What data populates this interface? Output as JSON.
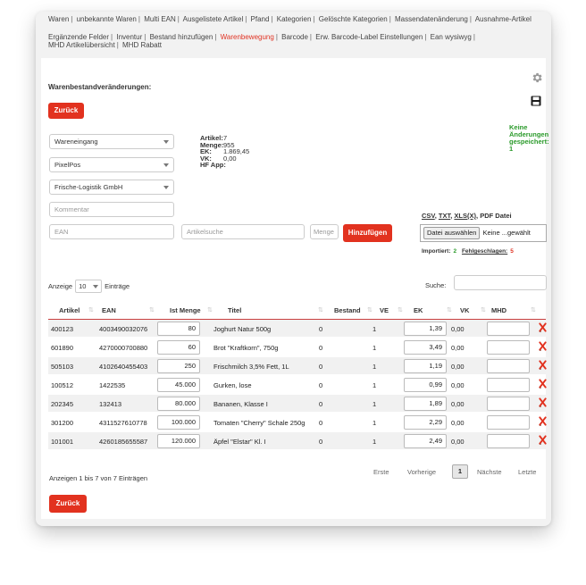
{
  "nav": {
    "row1": [
      "Waren",
      "unbekannte Waren",
      "Multi EAN",
      "Ausgelistete Artikel",
      "Pfand",
      "Kategorien",
      "Gelöschte Kategorien",
      "Massendatenänderung",
      "Ausnahme-Artikel"
    ],
    "row2": [
      "Ergänzende Felder",
      "Inventur",
      "Bestand hinzufügen",
      "Warenbewegung",
      "Barcode",
      "Erw. Barcode-Label Einstellungen",
      "Ean wysiwyg",
      "MHD Artikelübersicht",
      "MHD Rabatt"
    ],
    "active": "Warenbewegung"
  },
  "page_title": "Warenbestandveränderungen:",
  "buttons": {
    "back": "Zurück",
    "add": "Hinzufügen"
  },
  "no_changes": "Keine Änderungen gespeichert: 1",
  "selects": {
    "type": "Wareneingang",
    "source": "PixelPos",
    "supplier": "Frische-Logistik GmbH"
  },
  "inputs": {
    "comment_placeholder": "Kommentar",
    "ean_placeholder": "EAN",
    "search_placeholder": "Artikelsuche",
    "menge_placeholder": "Menge"
  },
  "stats": [
    {
      "label": "Artikel:",
      "value": "7"
    },
    {
      "label": "Menge:",
      "value": "955"
    },
    {
      "label": "EK:",
      "value": "1.869,45"
    },
    {
      "label": "VK:",
      "value": "0,00"
    },
    {
      "label": "HF App:",
      "value": ""
    }
  ],
  "import": {
    "formats": [
      "CSV",
      "TXT",
      "XLS(X)"
    ],
    "pdf": "PDF Datei",
    "file_button": "Datei auswählen",
    "file_name": "Keine ...gewählt",
    "imported_label": "Importiert:",
    "imported_count": "2",
    "failed_label": "Fehlgeschlagen:",
    "failed_count": "5"
  },
  "table_controls": {
    "show": "Anzeige",
    "page_length": "10",
    "entries": "Einträge",
    "search_label": "Suche:"
  },
  "columns": [
    "Artikel",
    "EAN",
    "Ist Menge",
    "Titel",
    "Bestand",
    "VE",
    "EK",
    "VK",
    "MHD"
  ],
  "rows": [
    {
      "artikel": "400123",
      "ean": "4003490032076",
      "menge": "80",
      "titel": "Joghurt Natur 500g",
      "bestand": "0",
      "ve": "1",
      "ek": "1,39",
      "vk": "0,00"
    },
    {
      "artikel": "601890",
      "ean": "4270000700880",
      "menge": "60",
      "titel": "Brot \"Kraftkorn\", 750g",
      "bestand": "0",
      "ve": "1",
      "ek": "3,49",
      "vk": "0,00"
    },
    {
      "artikel": "505103",
      "ean": "4102640455403",
      "menge": "250",
      "titel": "Frischmilch 3,5% Fett, 1L",
      "bestand": "0",
      "ve": "1",
      "ek": "1,19",
      "vk": "0,00"
    },
    {
      "artikel": "100512",
      "ean": "1422535",
      "menge": "45.000",
      "titel": "Gurken, lose",
      "bestand": "0",
      "ve": "1",
      "ek": "0,99",
      "vk": "0,00"
    },
    {
      "artikel": "202345",
      "ean": "132413",
      "menge": "80.000",
      "titel": "Bananen, Klasse I",
      "bestand": "0",
      "ve": "1",
      "ek": "1,89",
      "vk": "0,00"
    },
    {
      "artikel": "301200",
      "ean": "4311527610778",
      "menge": "100.000",
      "titel": "Tomaten \"Cherry\" Schale 250g",
      "bestand": "0",
      "ve": "1",
      "ek": "2,29",
      "vk": "0,00"
    },
    {
      "artikel": "101001",
      "ean": "4260185655587",
      "menge": "120.000",
      "titel": "Äpfel \"Elstar\" Kl. I",
      "bestand": "0",
      "ve": "1",
      "ek": "2,49",
      "vk": "0,00"
    }
  ],
  "info": "Anzeigen 1 bis 7 von 7 Einträgen",
  "pager": {
    "first": "Erste",
    "prev": "Vorherige",
    "current": "1",
    "next": "Nächste",
    "last": "Letzte"
  },
  "colors": {
    "accent": "#e2321f",
    "success": "#2a9a2a"
  },
  "icons": {
    "settings": "gear-icon",
    "save": "floppy-disk-icon",
    "delete": "delete-x-icon"
  }
}
